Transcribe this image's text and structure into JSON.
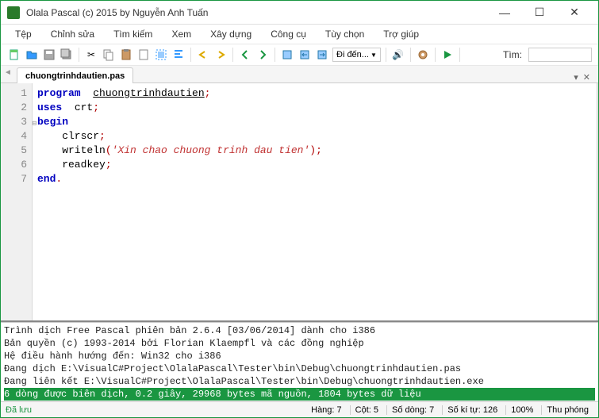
{
  "window": {
    "title": "Olala Pascal (c) 2015 by Nguyễn Anh Tuấn"
  },
  "menu": {
    "items": [
      "Tệp",
      "Chỉnh sửa",
      "Tìm kiếm",
      "Xem",
      "Xây dựng",
      "Công cụ",
      "Tùy chọn",
      "Trợ giúp"
    ]
  },
  "toolbar": {
    "goto_label": "Đi đến...",
    "search_label": "Tìm:",
    "search_value": ""
  },
  "tab": {
    "filename": "chuongtrinhdautien.pas"
  },
  "editor": {
    "lines": [
      {
        "n": 1,
        "tokens": [
          [
            "kw",
            "program"
          ],
          [
            "",
            ""
          ],
          [
            "uline",
            "chuongtrinhdautien"
          ],
          [
            "punc",
            ";"
          ]
        ]
      },
      {
        "n": 2,
        "tokens": [
          [
            "kw",
            "uses"
          ],
          [
            "",
            ""
          ],
          [
            "",
            "crt"
          ],
          [
            "punc",
            ";"
          ]
        ]
      },
      {
        "n": 3,
        "fold": true,
        "tokens": [
          [
            "kw",
            "begin"
          ]
        ]
      },
      {
        "n": 4,
        "indent": 4,
        "tokens": [
          [
            "",
            "clrscr"
          ],
          [
            "punc",
            ";"
          ]
        ]
      },
      {
        "n": 5,
        "indent": 4,
        "tokens": [
          [
            "",
            "writeln"
          ],
          [
            "punc",
            "("
          ],
          [
            "str",
            "'Xin chao chuong trinh dau tien'"
          ],
          [
            "punc",
            ")"
          ],
          [
            "punc",
            ";"
          ]
        ]
      },
      {
        "n": 6,
        "indent": 4,
        "tokens": [
          [
            "",
            "readkey"
          ],
          [
            "punc",
            ";"
          ]
        ]
      },
      {
        "n": 7,
        "tokens": [
          [
            "kw",
            "end"
          ],
          [
            "punc",
            "."
          ]
        ]
      }
    ]
  },
  "output": {
    "lines": [
      "Trình dịch Free Pascal phiên bản 2.6.4 [03/06/2014] dành cho i386",
      "Bản quyền (c) 1993-2014 bởi Florian Klaempfl và các đồng nghiệp",
      "Hệ điều hành hướng đến: Win32 cho i386",
      "Đang dịch E:\\VisualC#Project\\OlalaPascal\\Tester\\bin\\Debug\\chuongtrinhdautien.pas",
      "Đang liên kết E:\\VisualC#Project\\OlalaPascal\\Tester\\bin\\Debug\\chuongtrinhdautien.exe"
    ],
    "success_line": "6 dòng được biên dịch, 0.2 giây, 29968 bytes mã nguồn, 1804 bytes dữ liệu"
  },
  "status": {
    "saved": "Đã lưu",
    "row": "Hàng: 7",
    "col": "Cột: 5",
    "lines": "Số dòng: 7",
    "chars": "Số kí tự: 126",
    "zoom": "100%",
    "mode": "Thu phóng"
  }
}
